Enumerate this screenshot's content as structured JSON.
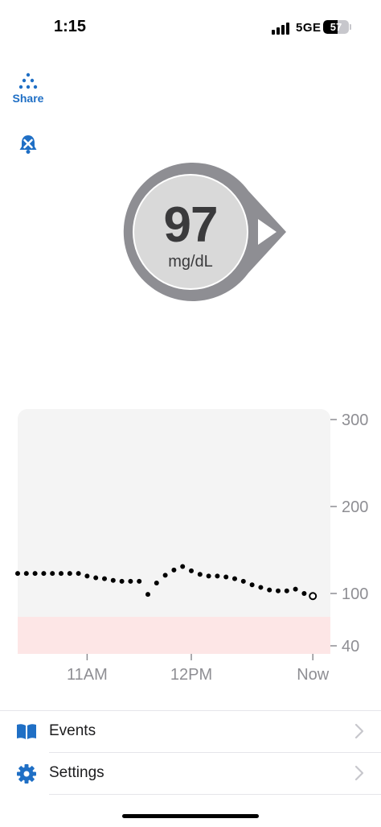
{
  "status_bar": {
    "time": "1:15",
    "network": "5GE",
    "battery_percent": "57",
    "battery_level": 0.57,
    "signal_bars": 4
  },
  "toolbar": {
    "share_label": "Share",
    "share_icon": "share-dots-icon",
    "alert_icon": "bell-muted-icon"
  },
  "reading": {
    "value": "97",
    "unit": "mg/dL",
    "trend": "steady",
    "ring_color": "#8e8e93",
    "fill_color": "#d9d9d9"
  },
  "chart_data": {
    "type": "scatter",
    "y_ticks": [
      "300",
      "200",
      "100",
      "40"
    ],
    "x_ticks": [
      "11AM",
      "12PM",
      "Now"
    ],
    "ylim": [
      40,
      300
    ],
    "low_range": [
      40,
      70
    ],
    "grid": false,
    "background": "#f4f4f4",
    "low_range_color": "#fde6e6",
    "point_color": "#000000",
    "points": [
      {
        "t": 0,
        "v": 123
      },
      {
        "t": 5,
        "v": 123
      },
      {
        "t": 10,
        "v": 123
      },
      {
        "t": 15,
        "v": 123
      },
      {
        "t": 20,
        "v": 123
      },
      {
        "t": 25,
        "v": 123
      },
      {
        "t": 30,
        "v": 123
      },
      {
        "t": 35,
        "v": 123
      },
      {
        "t": 40,
        "v": 120
      },
      {
        "t": 45,
        "v": 118
      },
      {
        "t": 50,
        "v": 117
      },
      {
        "t": 55,
        "v": 115
      },
      {
        "t": 60,
        "v": 114
      },
      {
        "t": 65,
        "v": 114
      },
      {
        "t": 70,
        "v": 114
      },
      {
        "t": 75,
        "v": 99
      },
      {
        "t": 80,
        "v": 112
      },
      {
        "t": 85,
        "v": 121
      },
      {
        "t": 90,
        "v": 127
      },
      {
        "t": 95,
        "v": 131
      },
      {
        "t": 100,
        "v": 126
      },
      {
        "t": 105,
        "v": 122
      },
      {
        "t": 110,
        "v": 120
      },
      {
        "t": 115,
        "v": 120
      },
      {
        "t": 120,
        "v": 119
      },
      {
        "t": 125,
        "v": 117
      },
      {
        "t": 130,
        "v": 114
      },
      {
        "t": 135,
        "v": 110
      },
      {
        "t": 140,
        "v": 107
      },
      {
        "t": 145,
        "v": 104
      },
      {
        "t": 150,
        "v": 103
      },
      {
        "t": 155,
        "v": 103
      },
      {
        "t": 160,
        "v": 105
      },
      {
        "t": 165,
        "v": 100
      },
      {
        "t": 170,
        "v": 97
      }
    ],
    "x_tick_times": [
      40,
      100,
      170
    ],
    "x_range": [
      0,
      175
    ]
  },
  "menu": {
    "items": [
      {
        "label": "Events",
        "icon": "book-icon"
      },
      {
        "label": "Settings",
        "icon": "gear-icon"
      }
    ],
    "accent": "#1f6fc5"
  }
}
